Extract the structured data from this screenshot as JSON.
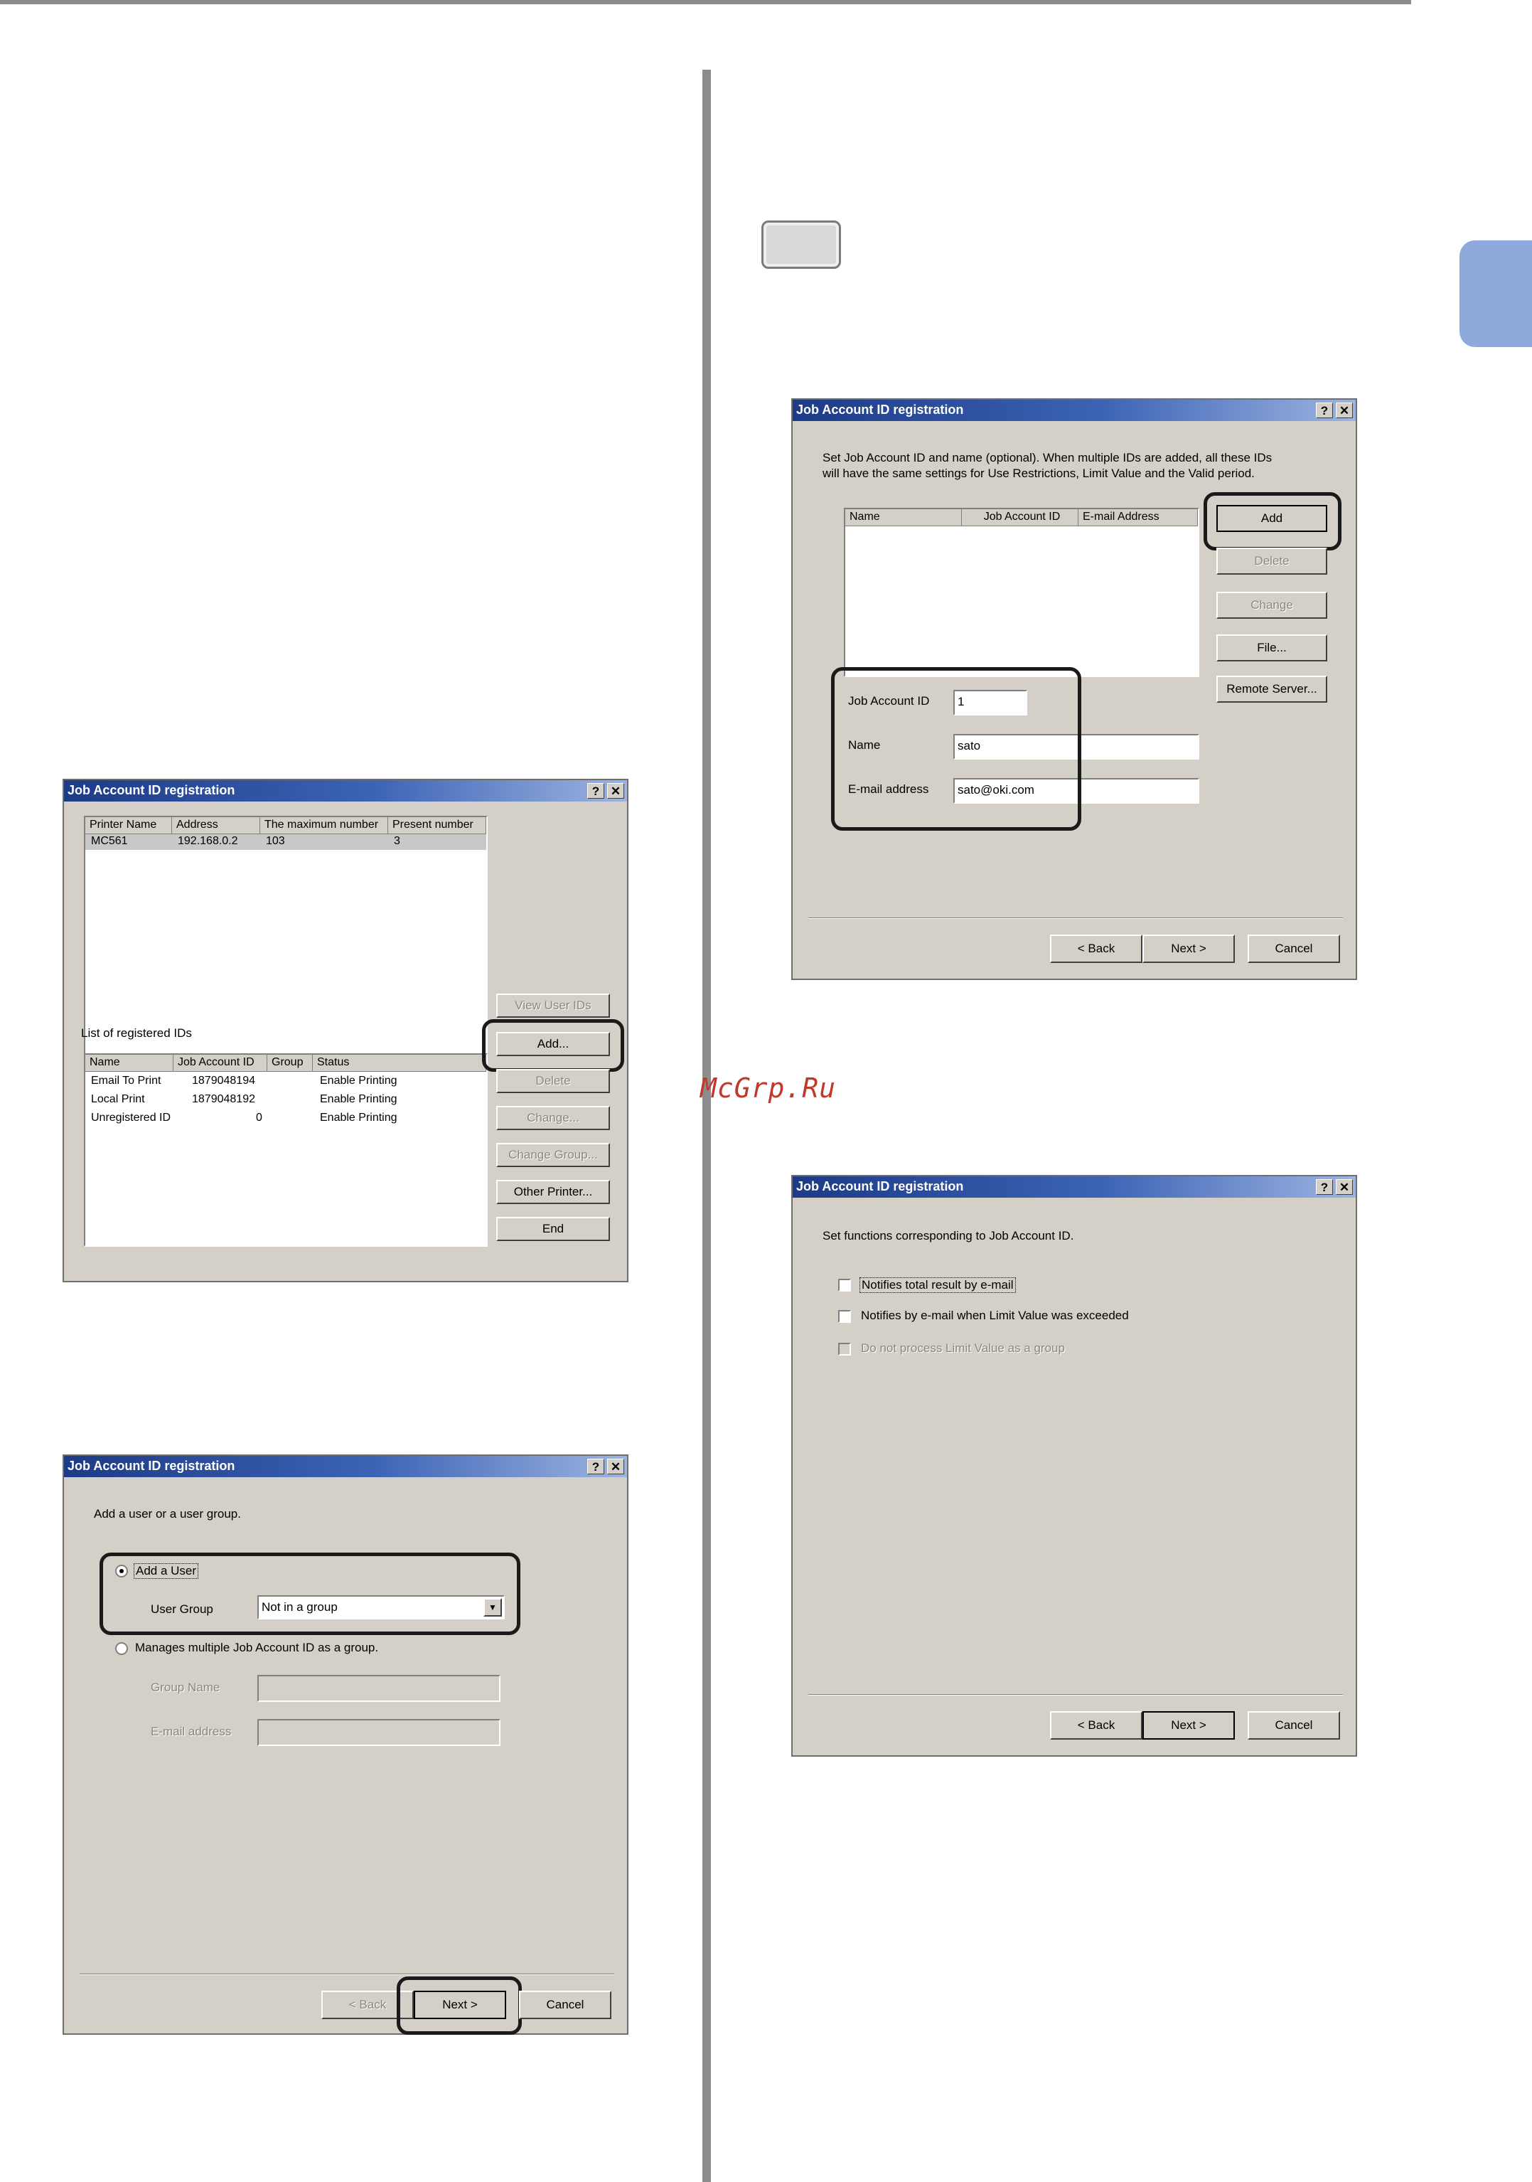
{
  "windows": {
    "w1": {
      "title": "Job Account ID registration",
      "help": "?",
      "close": "✕",
      "printers": {
        "headers": [
          "Printer Name",
          "Address",
          "The maximum number",
          "Present number"
        ],
        "rows": [
          [
            "MC561",
            "192.168.0.2",
            "103",
            "3"
          ]
        ]
      },
      "view_ids_label": "View User IDs",
      "list_label": "List of registered IDs",
      "registered": {
        "headers": [
          "Name",
          "Job Account ID",
          "Group",
          "Status"
        ],
        "rows": [
          [
            "Email To Print",
            "1879048194",
            "",
            "Enable Printing"
          ],
          [
            "Local Print",
            "1879048192",
            "",
            "Enable Printing"
          ],
          [
            "Unregistered ID",
            "0",
            "",
            "Enable Printing"
          ]
        ]
      },
      "buttons": {
        "add": "Add...",
        "delete": "Delete",
        "change": "Change...",
        "change_group": "Change Group...",
        "other_printer": "Other Printer...",
        "end": "End"
      }
    },
    "w2": {
      "title": "Job Account ID registration",
      "help": "?",
      "close": "✕",
      "prompt": "Add a user or a user group.",
      "add_user": "Add a User",
      "user_group_label": "User Group",
      "user_group_value": "Not in a group",
      "manage_group": "Manages multiple Job Account ID as a group.",
      "group_name_label": "Group Name",
      "email_label": "E-mail address",
      "back": "< Back",
      "next": "Next >",
      "cancel": "Cancel"
    },
    "w3": {
      "title": "Job Account ID registration",
      "help": "?",
      "close": "✕",
      "desc_line1": "Set Job Account ID and name (optional). When multiple IDs are added, all these IDs",
      "desc_line2": "will have the same settings for Use Restrictions, Limit Value and the Valid period.",
      "headers": [
        "Name",
        "Job Account ID",
        "E-mail Address"
      ],
      "buttons": {
        "add": "Add",
        "delete": "Delete",
        "change": "Change",
        "file": "File...",
        "remote": "Remote Server..."
      },
      "id_label": "Job Account ID",
      "id_value": "1",
      "name_label": "Name",
      "name_value": "sato",
      "email_label": "E-mail address",
      "email_value": "sato@oki.com",
      "back": "< Back",
      "next": "Next >",
      "cancel": "Cancel"
    },
    "w4": {
      "title": "Job Account ID registration",
      "help": "?",
      "close": "✕",
      "prompt": "Set functions corresponding to Job Account ID.",
      "opt1": "Notifies total result by e-mail",
      "opt2": "Notifies by e-mail when Limit Value was exceeded",
      "opt3": "Do not process Limit Value as a group",
      "back": "< Back",
      "next": "Next >",
      "cancel": "Cancel"
    }
  },
  "watermark": "McGrp.Ru"
}
